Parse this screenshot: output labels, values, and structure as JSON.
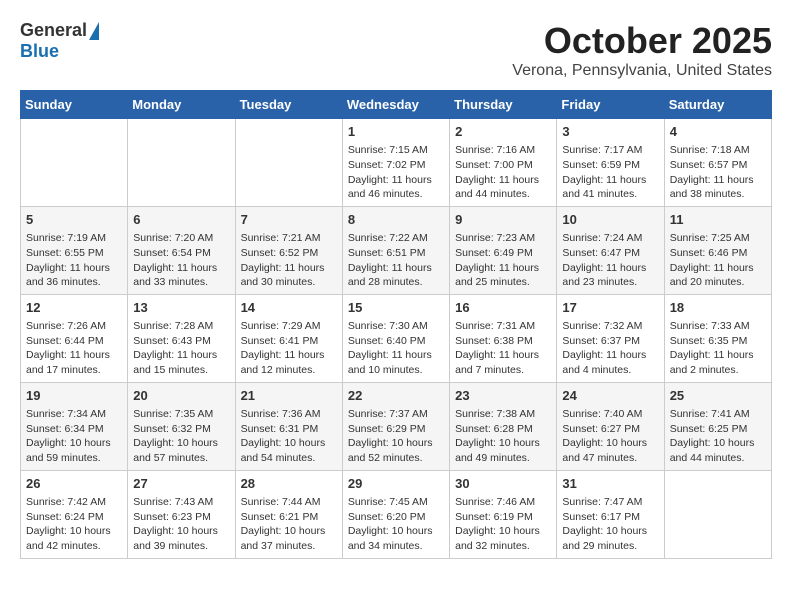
{
  "header": {
    "logo_general": "General",
    "logo_blue": "Blue",
    "month": "October 2025",
    "location": "Verona, Pennsylvania, United States"
  },
  "weekdays": [
    "Sunday",
    "Monday",
    "Tuesday",
    "Wednesday",
    "Thursday",
    "Friday",
    "Saturday"
  ],
  "weeks": [
    [
      {
        "day": "",
        "info": ""
      },
      {
        "day": "",
        "info": ""
      },
      {
        "day": "",
        "info": ""
      },
      {
        "day": "1",
        "info": "Sunrise: 7:15 AM\nSunset: 7:02 PM\nDaylight: 11 hours\nand 46 minutes."
      },
      {
        "day": "2",
        "info": "Sunrise: 7:16 AM\nSunset: 7:00 PM\nDaylight: 11 hours\nand 44 minutes."
      },
      {
        "day": "3",
        "info": "Sunrise: 7:17 AM\nSunset: 6:59 PM\nDaylight: 11 hours\nand 41 minutes."
      },
      {
        "day": "4",
        "info": "Sunrise: 7:18 AM\nSunset: 6:57 PM\nDaylight: 11 hours\nand 38 minutes."
      }
    ],
    [
      {
        "day": "5",
        "info": "Sunrise: 7:19 AM\nSunset: 6:55 PM\nDaylight: 11 hours\nand 36 minutes."
      },
      {
        "day": "6",
        "info": "Sunrise: 7:20 AM\nSunset: 6:54 PM\nDaylight: 11 hours\nand 33 minutes."
      },
      {
        "day": "7",
        "info": "Sunrise: 7:21 AM\nSunset: 6:52 PM\nDaylight: 11 hours\nand 30 minutes."
      },
      {
        "day": "8",
        "info": "Sunrise: 7:22 AM\nSunset: 6:51 PM\nDaylight: 11 hours\nand 28 minutes."
      },
      {
        "day": "9",
        "info": "Sunrise: 7:23 AM\nSunset: 6:49 PM\nDaylight: 11 hours\nand 25 minutes."
      },
      {
        "day": "10",
        "info": "Sunrise: 7:24 AM\nSunset: 6:47 PM\nDaylight: 11 hours\nand 23 minutes."
      },
      {
        "day": "11",
        "info": "Sunrise: 7:25 AM\nSunset: 6:46 PM\nDaylight: 11 hours\nand 20 minutes."
      }
    ],
    [
      {
        "day": "12",
        "info": "Sunrise: 7:26 AM\nSunset: 6:44 PM\nDaylight: 11 hours\nand 17 minutes."
      },
      {
        "day": "13",
        "info": "Sunrise: 7:28 AM\nSunset: 6:43 PM\nDaylight: 11 hours\nand 15 minutes."
      },
      {
        "day": "14",
        "info": "Sunrise: 7:29 AM\nSunset: 6:41 PM\nDaylight: 11 hours\nand 12 minutes."
      },
      {
        "day": "15",
        "info": "Sunrise: 7:30 AM\nSunset: 6:40 PM\nDaylight: 11 hours\nand 10 minutes."
      },
      {
        "day": "16",
        "info": "Sunrise: 7:31 AM\nSunset: 6:38 PM\nDaylight: 11 hours\nand 7 minutes."
      },
      {
        "day": "17",
        "info": "Sunrise: 7:32 AM\nSunset: 6:37 PM\nDaylight: 11 hours\nand 4 minutes."
      },
      {
        "day": "18",
        "info": "Sunrise: 7:33 AM\nSunset: 6:35 PM\nDaylight: 11 hours\nand 2 minutes."
      }
    ],
    [
      {
        "day": "19",
        "info": "Sunrise: 7:34 AM\nSunset: 6:34 PM\nDaylight: 10 hours\nand 59 minutes."
      },
      {
        "day": "20",
        "info": "Sunrise: 7:35 AM\nSunset: 6:32 PM\nDaylight: 10 hours\nand 57 minutes."
      },
      {
        "day": "21",
        "info": "Sunrise: 7:36 AM\nSunset: 6:31 PM\nDaylight: 10 hours\nand 54 minutes."
      },
      {
        "day": "22",
        "info": "Sunrise: 7:37 AM\nSunset: 6:29 PM\nDaylight: 10 hours\nand 52 minutes."
      },
      {
        "day": "23",
        "info": "Sunrise: 7:38 AM\nSunset: 6:28 PM\nDaylight: 10 hours\nand 49 minutes."
      },
      {
        "day": "24",
        "info": "Sunrise: 7:40 AM\nSunset: 6:27 PM\nDaylight: 10 hours\nand 47 minutes."
      },
      {
        "day": "25",
        "info": "Sunrise: 7:41 AM\nSunset: 6:25 PM\nDaylight: 10 hours\nand 44 minutes."
      }
    ],
    [
      {
        "day": "26",
        "info": "Sunrise: 7:42 AM\nSunset: 6:24 PM\nDaylight: 10 hours\nand 42 minutes."
      },
      {
        "day": "27",
        "info": "Sunrise: 7:43 AM\nSunset: 6:23 PM\nDaylight: 10 hours\nand 39 minutes."
      },
      {
        "day": "28",
        "info": "Sunrise: 7:44 AM\nSunset: 6:21 PM\nDaylight: 10 hours\nand 37 minutes."
      },
      {
        "day": "29",
        "info": "Sunrise: 7:45 AM\nSunset: 6:20 PM\nDaylight: 10 hours\nand 34 minutes."
      },
      {
        "day": "30",
        "info": "Sunrise: 7:46 AM\nSunset: 6:19 PM\nDaylight: 10 hours\nand 32 minutes."
      },
      {
        "day": "31",
        "info": "Sunrise: 7:47 AM\nSunset: 6:17 PM\nDaylight: 10 hours\nand 29 minutes."
      },
      {
        "day": "",
        "info": ""
      }
    ]
  ]
}
